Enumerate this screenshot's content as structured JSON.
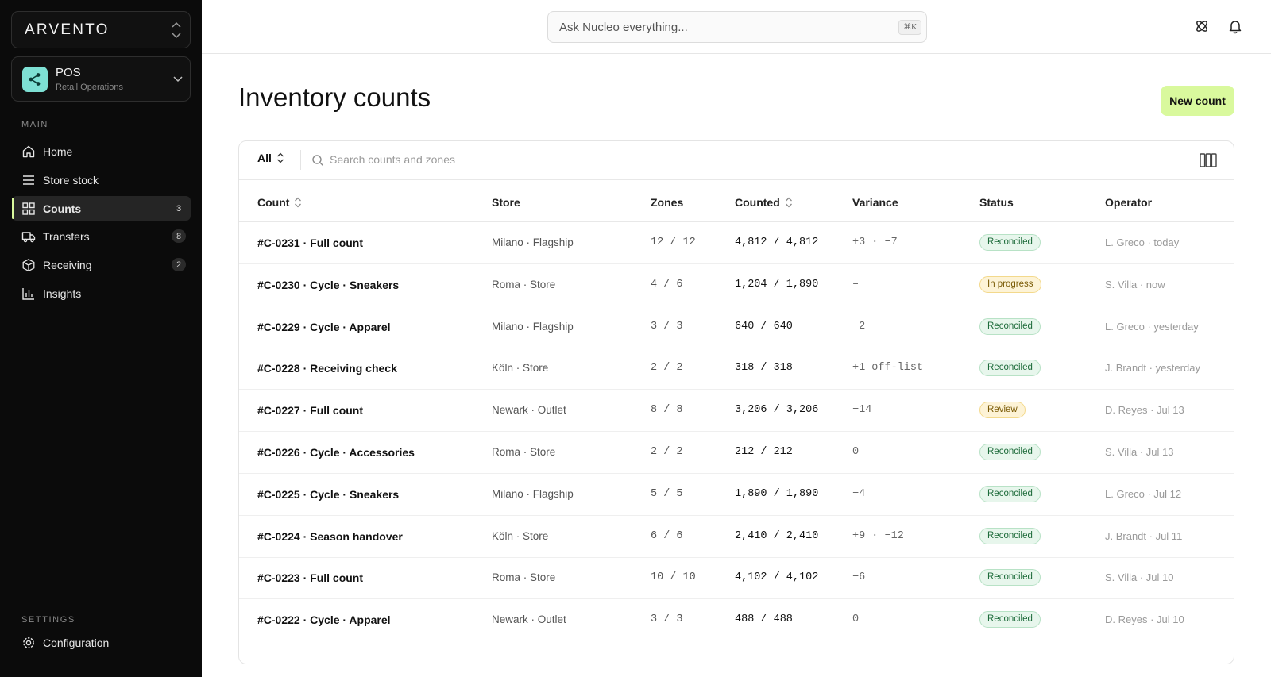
{
  "brand": {
    "name": "ARVENTO"
  },
  "workspace": {
    "title": "POS",
    "subtitle": "Retail Operations"
  },
  "sidebar": {
    "main_label": "MAIN",
    "items": [
      {
        "label": "Home",
        "icon": "home-icon",
        "badge": ""
      },
      {
        "label": "Store stock",
        "icon": "menu-lines-icon",
        "badge": ""
      },
      {
        "label": "Counts",
        "icon": "grid-icon",
        "badge": "3"
      },
      {
        "label": "Transfers",
        "icon": "truck-icon",
        "badge": "8"
      },
      {
        "label": "Receiving",
        "icon": "box-icon",
        "badge": "2"
      },
      {
        "label": "Insights",
        "icon": "bar-chart-icon",
        "badge": ""
      }
    ],
    "settings_label": "SETTINGS",
    "settings_item": "Configuration"
  },
  "topbar": {
    "search_placeholder": "Ask Nucleo everything...",
    "shortcut": "⌘K"
  },
  "page": {
    "title": "Inventory counts",
    "new_button": "New count"
  },
  "toolbar": {
    "filter": "All",
    "search_placeholder": "Search counts and zones"
  },
  "table": {
    "headers": {
      "count": "Count",
      "store": "Store",
      "zones": "Zones",
      "counted": "Counted",
      "variance": "Variance",
      "status": "Status",
      "operator": "Operator"
    },
    "rows": [
      {
        "count": "#C-0231 · Full count",
        "store": "Milano · Flagship",
        "zones": "12 / 12",
        "counted": "4,812 / 4,812",
        "variance": "+3 · −7",
        "status": "Reconciled",
        "operator": "L. Greco · today"
      },
      {
        "count": "#C-0230 · Cycle · Sneakers",
        "store": "Roma · Store",
        "zones": "4 / 6",
        "counted": "1,204 / 1,890",
        "variance": "–",
        "status": "In progress",
        "operator": "S. Villa · now"
      },
      {
        "count": "#C-0229 · Cycle · Apparel",
        "store": "Milano · Flagship",
        "zones": "3 / 3",
        "counted": "640 / 640",
        "variance": "−2",
        "status": "Reconciled",
        "operator": "L. Greco · yesterday"
      },
      {
        "count": "#C-0228 · Receiving check",
        "store": "Köln · Store",
        "zones": "2 / 2",
        "counted": "318 / 318",
        "variance": "+1 off-list",
        "status": "Reconciled",
        "operator": "J. Brandt · yesterday"
      },
      {
        "count": "#C-0227 · Full count",
        "store": "Newark · Outlet",
        "zones": "8 / 8",
        "counted": "3,206 / 3,206",
        "variance": "−14",
        "status": "Review",
        "operator": "D. Reyes · Jul 13"
      },
      {
        "count": "#C-0226 · Cycle · Accessories",
        "store": "Roma · Store",
        "zones": "2 / 2",
        "counted": "212 / 212",
        "variance": "0",
        "status": "Reconciled",
        "operator": "S. Villa · Jul 13"
      },
      {
        "count": "#C-0225 · Cycle · Sneakers",
        "store": "Milano · Flagship",
        "zones": "5 / 5",
        "counted": "1,890 / 1,890",
        "variance": "−4",
        "status": "Reconciled",
        "operator": "L. Greco · Jul 12"
      },
      {
        "count": "#C-0224 · Season handover",
        "store": "Köln · Store",
        "zones": "6 / 6",
        "counted": "2,410 / 2,410",
        "variance": "+9 · −12",
        "status": "Reconciled",
        "operator": "J. Brandt · Jul 11"
      },
      {
        "count": "#C-0223 · Full count",
        "store": "Roma · Store",
        "zones": "10 / 10",
        "counted": "4,102 / 4,102",
        "variance": "−6",
        "status": "Reconciled",
        "operator": "S. Villa · Jul 10"
      },
      {
        "count": "#C-0222 · Cycle · Apparel",
        "store": "Newark · Outlet",
        "zones": "3 / 3",
        "counted": "488 / 488",
        "variance": "0",
        "status": "Reconciled",
        "operator": "D. Reyes · Jul 10"
      }
    ]
  },
  "colors": {
    "accent": "#d9f99d",
    "sidebar_bg": "#0b0b0b",
    "workspace_logo": "#7ee0d4",
    "reconciled": "#1d6b3a",
    "in_progress": "#7a5a05"
  }
}
